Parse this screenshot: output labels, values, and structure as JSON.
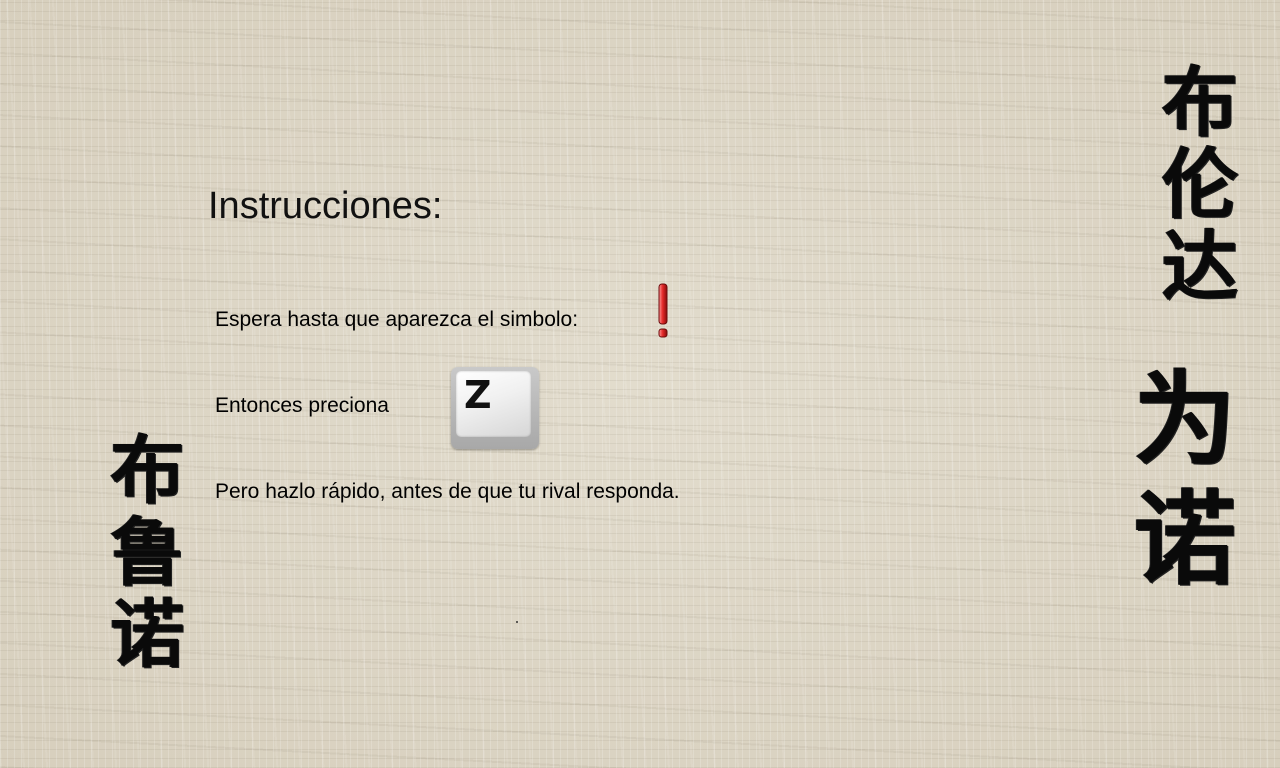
{
  "instructions": {
    "title": "Instrucciones:",
    "line1": "Espera hasta que aparezca el simbolo:",
    "line2": "Entonces preciona",
    "line3": "Pero hazlo rápido, antes de que tu rival responda."
  },
  "signal": {
    "icon": "red-exclamation-mark",
    "color": "#d42020"
  },
  "key": {
    "label": "Z",
    "icon": "keyboard-key"
  },
  "calligraphy": {
    "left": [
      "布",
      "鲁",
      "诺"
    ],
    "right_top": [
      "布",
      "伦",
      "达"
    ],
    "right_bottom": [
      "为",
      "诺"
    ]
  },
  "colors": {
    "background": "#ddd6c6",
    "text": "#000000",
    "ink": "#0a0a0a"
  }
}
